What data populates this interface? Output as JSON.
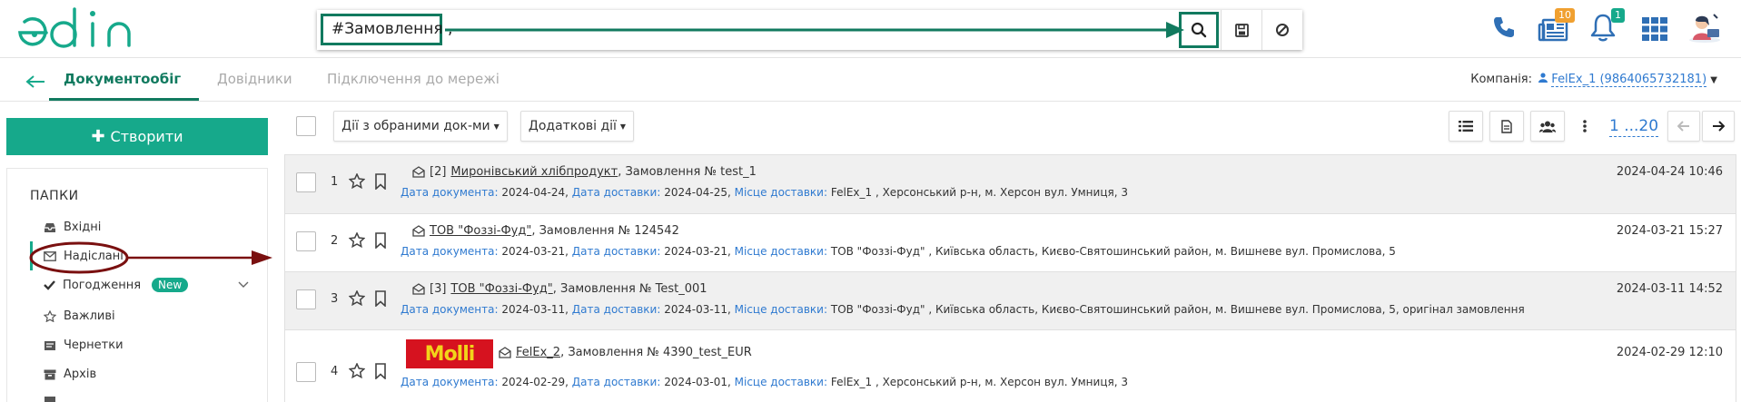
{
  "brand": {
    "name": "edin",
    "color": "#16a98b"
  },
  "search": {
    "query": "#Замовлення ,",
    "search_icon": "search-icon",
    "save_icon": "save-icon",
    "clear_icon": "cancel-icon"
  },
  "header": {
    "messages_badge": "10",
    "notifications_badge": "1"
  },
  "nav": {
    "back_icon": "arrow-left-icon",
    "tabs": [
      {
        "label": "Документообіг",
        "active": true
      },
      {
        "label": "Довідники",
        "active": false
      },
      {
        "label": "Підключення до мережі",
        "active": false
      }
    ],
    "company_label": "Компанія:",
    "company_value": "FelEx_1 (9864065732181)"
  },
  "sidebar": {
    "create_label": "Створити",
    "folders_title": "ПАПКИ",
    "items": [
      {
        "label": "Вхідні",
        "icon": "inbox-icon"
      },
      {
        "label": "Надіслані",
        "icon": "envelope-icon",
        "active": true
      },
      {
        "label": "Погодження",
        "icon": "check-icon",
        "badge": "New"
      },
      {
        "label": "Важливі",
        "icon": "star-icon"
      },
      {
        "label": "Чернетки",
        "icon": "draft-icon"
      },
      {
        "label": "Архів",
        "icon": "archive-icon"
      }
    ]
  },
  "toolbar": {
    "bulk_actions": "Дії з обраними док-ми",
    "extra_actions": "Додаткові дії",
    "pager": "1 ...20"
  },
  "documents": [
    {
      "num": "1",
      "prefix": "[2]",
      "company": "Миронівський хлібпродукт",
      "title": ", Замовлення № test_1",
      "datetime": "2024-04-24 10:46",
      "doc_date_label": "Дата документа:",
      "doc_date": "2024-04-24,",
      "delivery_date_label": "Дата доставки:",
      "delivery_date": "2024-04-25,",
      "place_label": "Місце доставки:",
      "place": "FelEx_1 , Херсонський р-н, м. Херсон вул. Умниця, 3"
    },
    {
      "num": "2",
      "prefix": "",
      "company": "ТОВ \"Фоззі-Фуд\"",
      "title": ", Замовлення № 124542",
      "datetime": "2024-03-21 15:27",
      "doc_date_label": "Дата документа:",
      "doc_date": "2024-03-21,",
      "delivery_date_label": "Дата доставки:",
      "delivery_date": "2024-03-21,",
      "place_label": "Місце доставки:",
      "place": "ТОВ \"Фоззі-Фуд\" , Київська область, Києво-Святошинський район, м. Вишневе вул. Промислова, 5"
    },
    {
      "num": "3",
      "prefix": "[3]",
      "company": "ТОВ \"Фоззі-Фуд\"",
      "title": ", Замовлення № Test_001",
      "datetime": "2024-03-11 14:52",
      "doc_date_label": "Дата документа:",
      "doc_date": "2024-03-11,",
      "delivery_date_label": "Дата доставки:",
      "delivery_date": "2024-03-11,",
      "place_label": "Місце доставки:",
      "place": "ТОВ \"Фоззі-Фуд\" , Київська область, Києво-Святошинський район, м. Вишневе вул. Промислова, 5, оригінал замовлення"
    },
    {
      "num": "4",
      "prefix": "",
      "company": "FelEx_2",
      "title": ", Замовлення № 4390_test_EUR",
      "datetime": "2024-02-29 12:10",
      "doc_date_label": "Дата документа:",
      "doc_date": "2024-02-29,",
      "delivery_date_label": "Дата доставки:",
      "delivery_date": "2024-03-01,",
      "place_label": "Місце доставки:",
      "place": "FelEx_1 , Херсонський р-н, м. Херсон вул. Умниця, 3",
      "logo_text": "Molli"
    }
  ],
  "colors": {
    "accent": "#16a98b",
    "annotation_green": "#117a5f",
    "annotation_red": "#7a1010",
    "link": "#2f7ad0",
    "toolbar_icon_blue": "#2f6fb5"
  }
}
